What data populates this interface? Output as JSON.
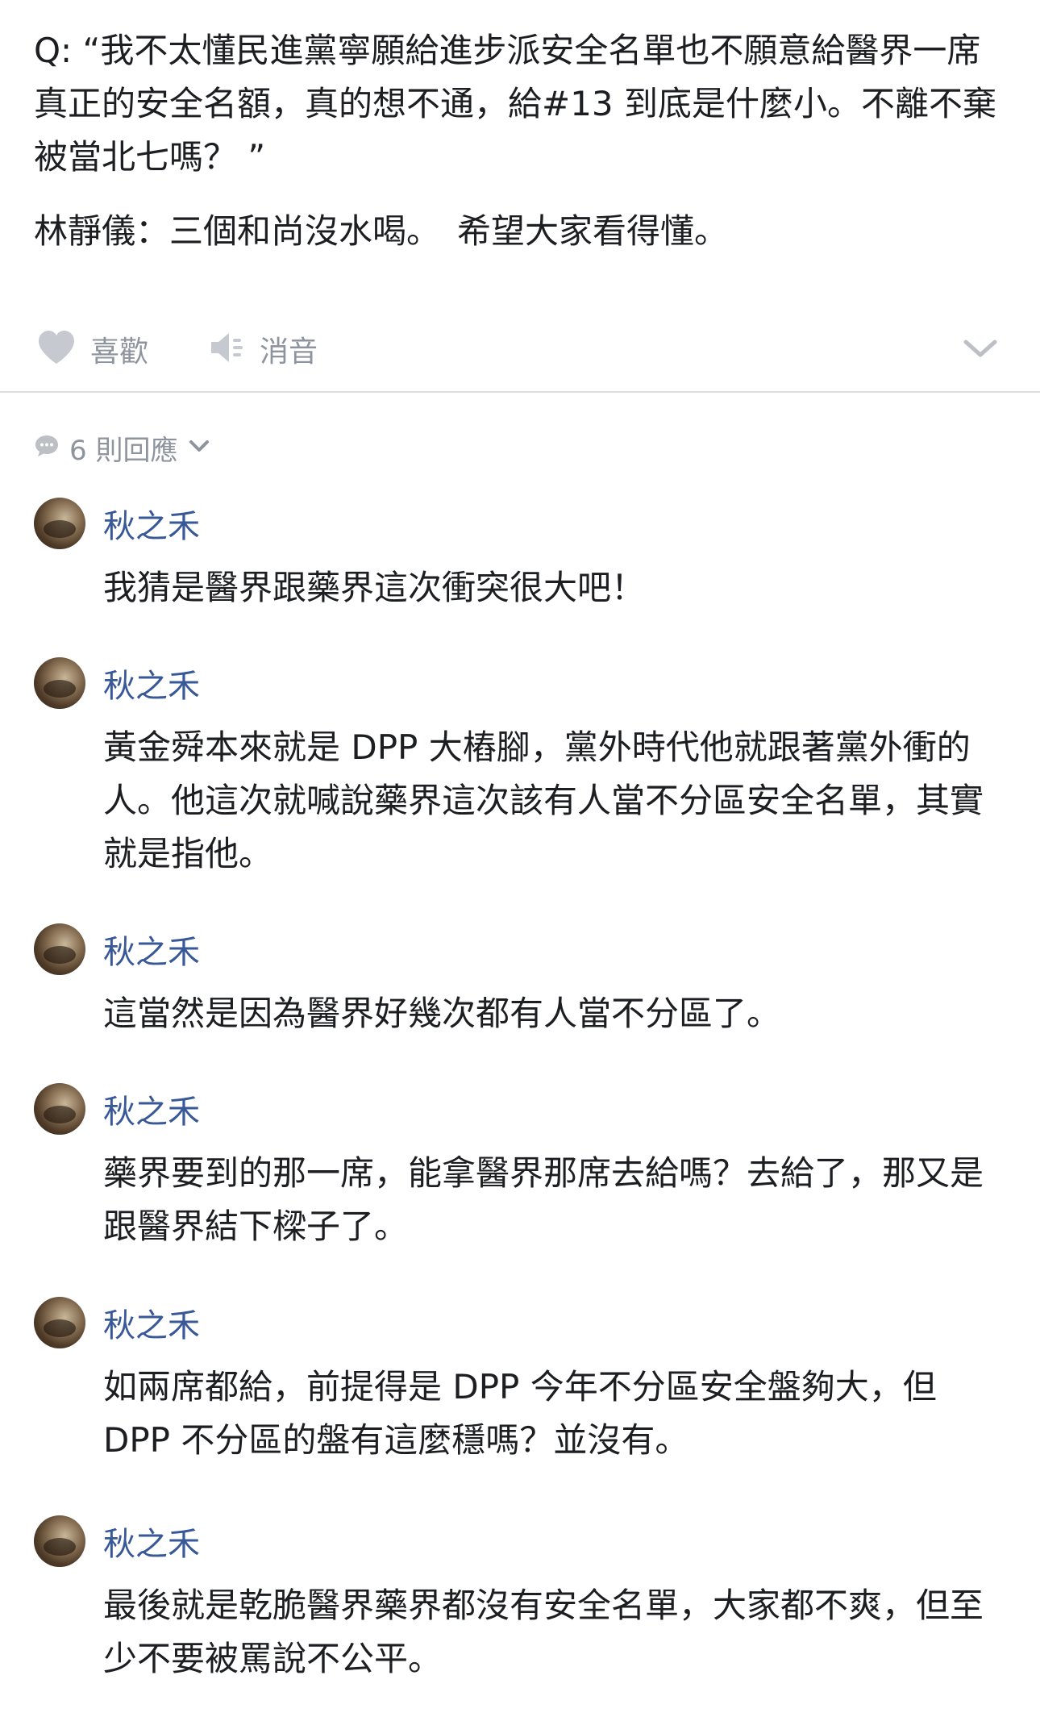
{
  "post": {
    "question": "Q: “我不太懂民進黨寧願給進步派安全名單也不願意給醫界一席真正的安全名額，真的想不通，給#13 到底是什麼小。不離不棄被當北七嗎？ ”",
    "answer": "林靜儀：三個和尚沒水喝。　希望大家看得懂。"
  },
  "actions": {
    "like_label": "喜歡",
    "mute_label": "消音"
  },
  "comments_header": {
    "count_label": "6 則回應"
  },
  "comments": [
    {
      "author": "秋之禾",
      "text": "我猜是醫界跟藥界這次衝突很大吧！"
    },
    {
      "author": "秋之禾",
      "text": "黃金舜本來就是 DPP 大樁腳，黨外時代他就跟著黨外衝的人。他這次就喊說藥界這次該有人當不分區安全名單，其實就是指他。"
    },
    {
      "author": "秋之禾",
      "text": "這當然是因為醫界好幾次都有人當不分區了。"
    },
    {
      "author": "秋之禾",
      "text": "藥界要到的那一席，能拿醫界那席去給嗎？去給了，那又是跟醫界結下樑子了。"
    },
    {
      "author": "秋之禾",
      "text": "如兩席都給，前提得是 DPP 今年不分區安全盤夠大，但 DPP 不分區的盤有這麼穩嗎？並沒有。"
    },
    {
      "author": "秋之禾",
      "text": "最後就是乾脆醫界藥界都沒有安全名單，大家都不爽，但至少不要被罵說不公平。"
    }
  ],
  "colors": {
    "author_link": "#385898",
    "muted_text": "#8d949e",
    "icon_gray": "#c6cad0",
    "divider": "#dadde1"
  }
}
